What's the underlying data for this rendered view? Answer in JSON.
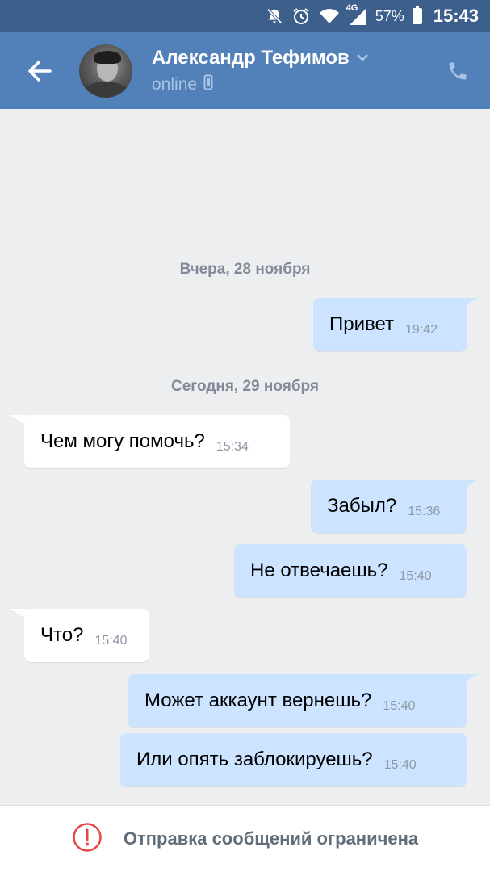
{
  "status_bar": {
    "icons": [
      "bell-off-icon",
      "alarm-icon",
      "wifi-icon",
      "signal-4g-icon"
    ],
    "network_label": "4G",
    "battery_percent": "57%",
    "time": "15:43"
  },
  "header": {
    "contact_name": "Александр Тефимов",
    "status": "online",
    "colors": {
      "header_bg": "#5181b8",
      "status_bar_bg": "#3d5f8c"
    }
  },
  "chat": {
    "date_separators": [
      "Вчера, 28 ноября",
      "Сегодня, 29 ноября"
    ],
    "messages": [
      {
        "direction": "out",
        "text": "Привет",
        "time": "19:42"
      },
      {
        "direction": "in",
        "text": "Чем могу помочь?",
        "time": "15:34"
      },
      {
        "direction": "out",
        "text": "Забыл?",
        "time": "15:36"
      },
      {
        "direction": "out",
        "text": "Не отвечаешь?",
        "time": "15:40"
      },
      {
        "direction": "in",
        "text": "Что?",
        "time": "15:40"
      },
      {
        "direction": "out",
        "text": "Может аккаунт вернешь?",
        "time": "15:40"
      },
      {
        "direction": "out",
        "text": "Или опять заблокируешь?",
        "time": "15:40"
      }
    ],
    "colors": {
      "outgoing_bubble": "#cce4ff",
      "incoming_bubble": "#ffffff",
      "background": "#edeef0"
    }
  },
  "footer": {
    "restricted_text": "Отправка сообщений ограничена",
    "icon": "alert-circle-icon",
    "icon_color": "#e64646"
  }
}
